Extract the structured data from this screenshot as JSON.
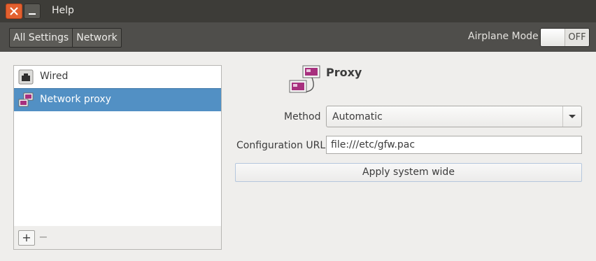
{
  "titlebar": {
    "menu_help": "Help"
  },
  "toolbar": {
    "crumbs": [
      "All Settings",
      "Network"
    ],
    "airplane_label": "Airplane Mode",
    "airplane_state": "OFF"
  },
  "sidebar": {
    "items": [
      {
        "label": "Wired",
        "icon": "ethernet-icon",
        "selected": false
      },
      {
        "label": "Network proxy",
        "icon": "network-proxy-icon",
        "selected": true
      }
    ],
    "add_label": "+",
    "remove_label": "−"
  },
  "detail": {
    "title": "Proxy",
    "method_label": "Method",
    "method_value": "Automatic",
    "url_label": "Configuration URL",
    "url_value": "file:///etc/gfw.pac",
    "apply_label": "Apply system wide"
  },
  "colors": {
    "selection": "#5290c4",
    "close_button": "#e2602f",
    "toolbar": "#4f4e4b"
  }
}
